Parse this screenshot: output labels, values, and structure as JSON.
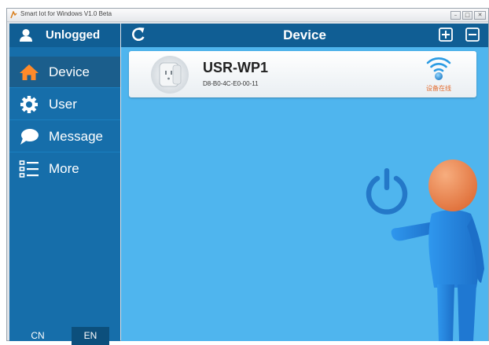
{
  "window": {
    "title": "Smart Iot for Windows V1.0 Beta",
    "controls": {
      "minimize": "–",
      "maximize": "□",
      "close": "✕"
    }
  },
  "sidebar": {
    "user_label": "Unlogged",
    "items": [
      {
        "label": "Device",
        "icon": "home-icon",
        "active": true
      },
      {
        "label": "User",
        "icon": "gear-icon",
        "active": false
      },
      {
        "label": "Message",
        "icon": "chat-bubble-icon",
        "active": false
      },
      {
        "label": "More",
        "icon": "list-icon",
        "active": false
      }
    ],
    "languages": [
      {
        "label": "CN",
        "selected": false
      },
      {
        "label": "EN",
        "selected": true
      }
    ]
  },
  "header": {
    "title": "Device"
  },
  "device": {
    "name": "USR-WP1",
    "mac": "D8-B0-4C-E0-00-11",
    "status": "设备在线"
  },
  "colors": {
    "sidebar_bg": "#166eaa",
    "header_bg": "#105e94",
    "main_bg": "#4fb5ee",
    "status_orange": "#e36c2e",
    "active_icon_orange": "#ff8a2a",
    "mascot_blue": "#2a8fe6",
    "mascot_head": "#ef8a55"
  }
}
